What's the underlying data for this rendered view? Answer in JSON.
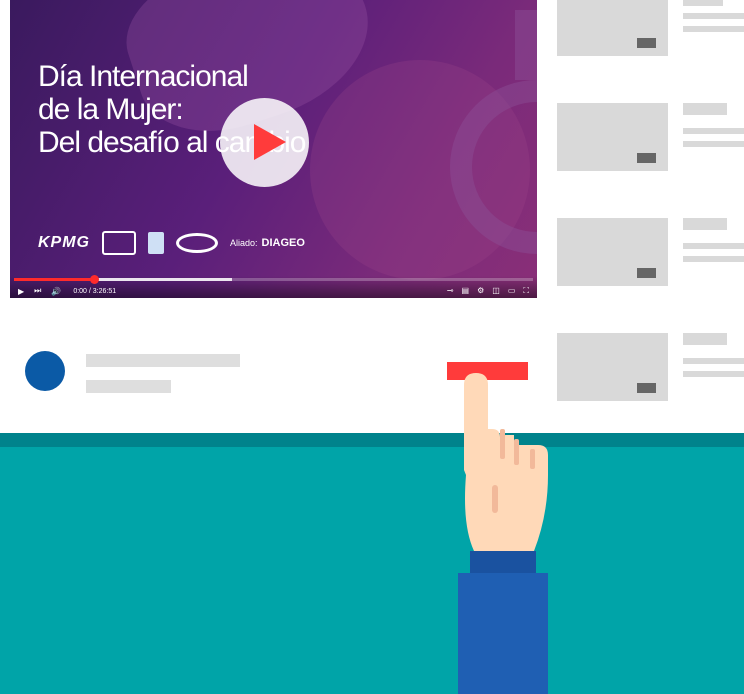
{
  "video": {
    "title_line1": "Día Internacional",
    "title_line2": "de la Mujer:",
    "title_line3": "Del desafío al cambio",
    "logos": {
      "kpmg": "KPMG",
      "aliado_label": "Aliado:",
      "aliado_brand": "DIAGEO"
    },
    "progress": 0.155,
    "buffered": 0.42,
    "time": "0:00 / 3:26:51"
  },
  "sidebar": {
    "items": [
      {
        "id": "related-1"
      },
      {
        "id": "related-2"
      },
      {
        "id": "related-3"
      },
      {
        "id": "related-4"
      }
    ]
  },
  "colors": {
    "accent": "#ff3b3b",
    "avatar": "#0b5aa6",
    "floor": "#00a4a8",
    "floor_edge": "#00838c",
    "sleeve": "#1f5fb3",
    "skin": "#ffd9b8"
  },
  "icons": [
    "play-icon",
    "next-icon",
    "volume-icon",
    "autoplay-toggle-icon",
    "subtitles-icon",
    "settings-icon",
    "miniplayer-icon",
    "theater-icon",
    "fullscreen-icon"
  ]
}
